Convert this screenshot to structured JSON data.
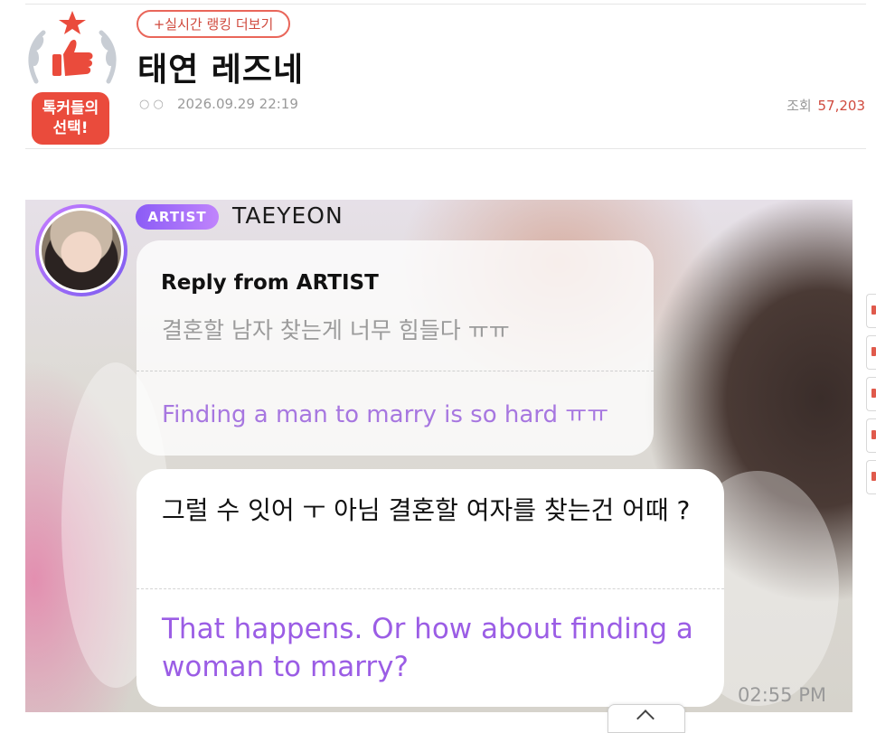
{
  "badge": {
    "pick_label": "톡커들의\n선택!",
    "star_color": "#ea4b3c"
  },
  "header": {
    "ranking_button": "+실시간 랭킹 더보기",
    "title": "태연 레즈네",
    "meta_dots": "○ ○",
    "date": "2026.09.29 22:19",
    "views_label": "조회",
    "views_count": "57,203"
  },
  "post_image": {
    "artist_tag": "ARTIST",
    "artist_name": "TAEYEON",
    "reply": {
      "heading": "Reply from ARTIST",
      "korean": "결혼할 남자 찾는게 너무 힘들다 ㅠㅠ",
      "english": "Finding a man to marry is so hard ㅠㅠ"
    },
    "answer": {
      "korean": "그럴 수 잇어 ㅜ 아님 결혼할 여자를 찾는건 어때 ?",
      "english": "That happens. Or how about finding a woman to marry?"
    },
    "timestamp": "02:55 PM"
  },
  "colors": {
    "accent_red": "#d04a3e",
    "purple": "#9b5de5"
  }
}
